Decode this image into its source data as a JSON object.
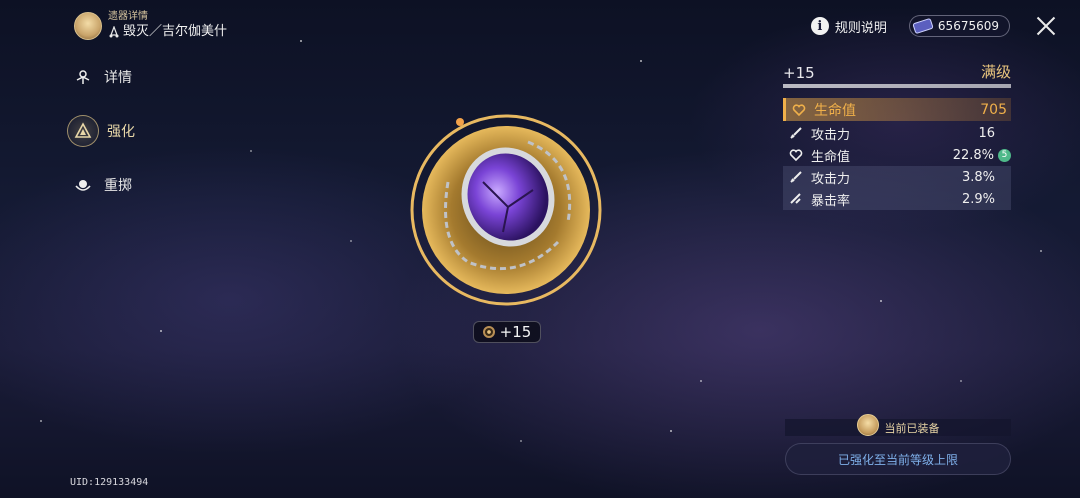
{
  "header": {
    "subtitle": "遗器详情",
    "path_name": "毁灭／吉尔伽美什"
  },
  "nav": [
    {
      "label": "详情",
      "icon": "details-icon",
      "active": false
    },
    {
      "label": "强化",
      "icon": "enhance-icon",
      "active": true
    },
    {
      "label": "重掷",
      "icon": "reroll-icon",
      "active": false
    }
  ],
  "top_right": {
    "rules_label": "规则说明",
    "currency_value": "65675609"
  },
  "relic": {
    "level_label": "+15"
  },
  "stats": {
    "level": "+15",
    "level_status": "满级",
    "main": {
      "name": "生命值",
      "value": "705"
    },
    "subs": [
      {
        "name": "攻击力",
        "value": "16",
        "icon": "sword-icon",
        "rolls": ""
      },
      {
        "name": "生命值",
        "value": "22.8%",
        "icon": "heart-icon",
        "rolls": "5"
      },
      {
        "name": "攻击力",
        "value": "3.8%",
        "icon": "sword-icon",
        "rolls": ""
      },
      {
        "name": "暴击率",
        "value": "2.9%",
        "icon": "crit-icon",
        "rolls": ""
      }
    ]
  },
  "footer": {
    "equipped_label": "当前已装备",
    "maxed_message": "已强化至当前等级上限",
    "uid": "UID:129133494"
  },
  "colors": {
    "accent_gold": "#f0b04a",
    "maxed_text": "#e9c57d",
    "roll_badge": "#4fb98a",
    "max_message": "#7fb0ea"
  }
}
